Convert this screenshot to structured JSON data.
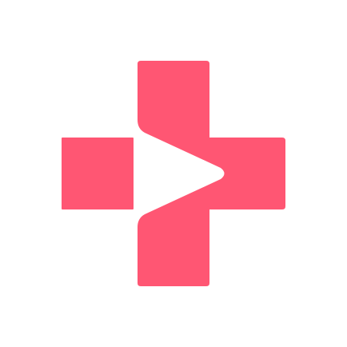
{
  "logo": {
    "icon": "medical-cross-play-icon",
    "brand_color": "#FF5673",
    "background_color": "#FFFFFF"
  }
}
